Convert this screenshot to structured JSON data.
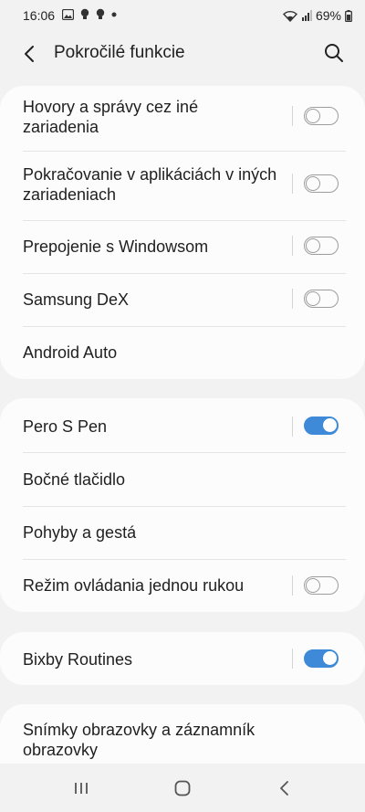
{
  "status_bar": {
    "time": "16:06",
    "notification_icons": [
      "image-icon",
      "bulb-icon",
      "bulb-icon",
      "dot-icon"
    ],
    "battery": "69%",
    "status_icons": [
      "wifi-icon",
      "signal-icon",
      "battery-icon"
    ]
  },
  "header": {
    "title": "Pokročilé funkcie",
    "back_icon": "back-arrow-icon",
    "search_icon": "search-icon"
  },
  "groups": [
    {
      "items": [
        {
          "label": "Hovory a správy cez iné zariadenia",
          "toggle": "off"
        },
        {
          "label": "Pokračovanie v aplikáciách v iných zariadeniach",
          "toggle": "off"
        },
        {
          "label": "Prepojenie s Windowsom",
          "toggle": "off"
        },
        {
          "label": "Samsung DeX",
          "toggle": "off"
        },
        {
          "label": "Android Auto",
          "toggle": null
        }
      ]
    },
    {
      "items": [
        {
          "label": "Pero S Pen",
          "toggle": "on"
        },
        {
          "label": "Bočné tlačidlo",
          "toggle": null
        },
        {
          "label": "Pohyby a gestá",
          "toggle": null
        },
        {
          "label": "Režim ovládania jednou rukou",
          "toggle": "off"
        }
      ]
    },
    {
      "items": [
        {
          "label": "Bixby Routines",
          "toggle": "on"
        }
      ]
    },
    {
      "items": [
        {
          "label": "Snímky obrazovky a záznamník obrazovky",
          "toggle": null
        }
      ]
    }
  ],
  "colors": {
    "accent": "#3e8ad8",
    "background": "#f2f2f2",
    "card": "#fcfcfc"
  },
  "nav_bar": {
    "icons": [
      "recent-apps-icon",
      "home-icon",
      "back-icon"
    ]
  }
}
